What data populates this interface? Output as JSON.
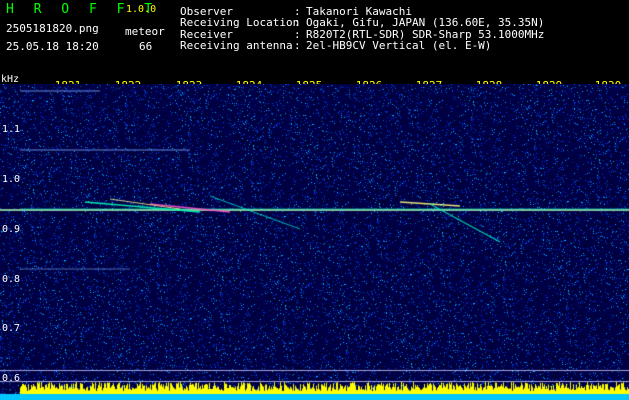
{
  "app": {
    "title": "H R O F F T",
    "version": "1.0.0"
  },
  "file": {
    "name": "2505181820.png",
    "datetime": "25.05.18 18:20"
  },
  "meteor": {
    "label": "meteor",
    "count": "66"
  },
  "info": [
    {
      "key": "Observer",
      "sep": ":",
      "value": "Takanori Kawachi"
    },
    {
      "key": "Receiving Location",
      "sep": ":",
      "value": "Ogaki, Gifu, JAPAN (136.60E, 35.35N)"
    },
    {
      "key": "Receiver",
      "sep": ":",
      "value": "R820T2(RTL-SDR) SDR-Sharp 53.1000MHz"
    },
    {
      "key": "Receiving antenna",
      "sep": ":",
      "value": "2el-HB9CV Vertical (el. E-W)"
    }
  ],
  "axis": {
    "unit": "kHz",
    "time_ticks": [
      "1821",
      "1822",
      "1823",
      "1824",
      "1825",
      "1826",
      "1827",
      "1828",
      "1829",
      "1830"
    ],
    "freq_ticks": [
      "1.1",
      "1.0",
      "0.9",
      "0.8",
      "0.7",
      "0.6"
    ]
  },
  "colors": {
    "title": "#00ff00",
    "version": "#ffff00",
    "info_key": "#ffffff",
    "info_value": "#ffffff",
    "file": "#ffffff",
    "meteor": "#ffffff",
    "tick_label": "#ffff00",
    "unit_label": "#ffffff",
    "freq_label": "#ffffff",
    "spectro_bg": "#00003c",
    "carrier": "#b4ffb4",
    "power_bar": "#ffff00",
    "baseline": "#00c8ff"
  }
}
